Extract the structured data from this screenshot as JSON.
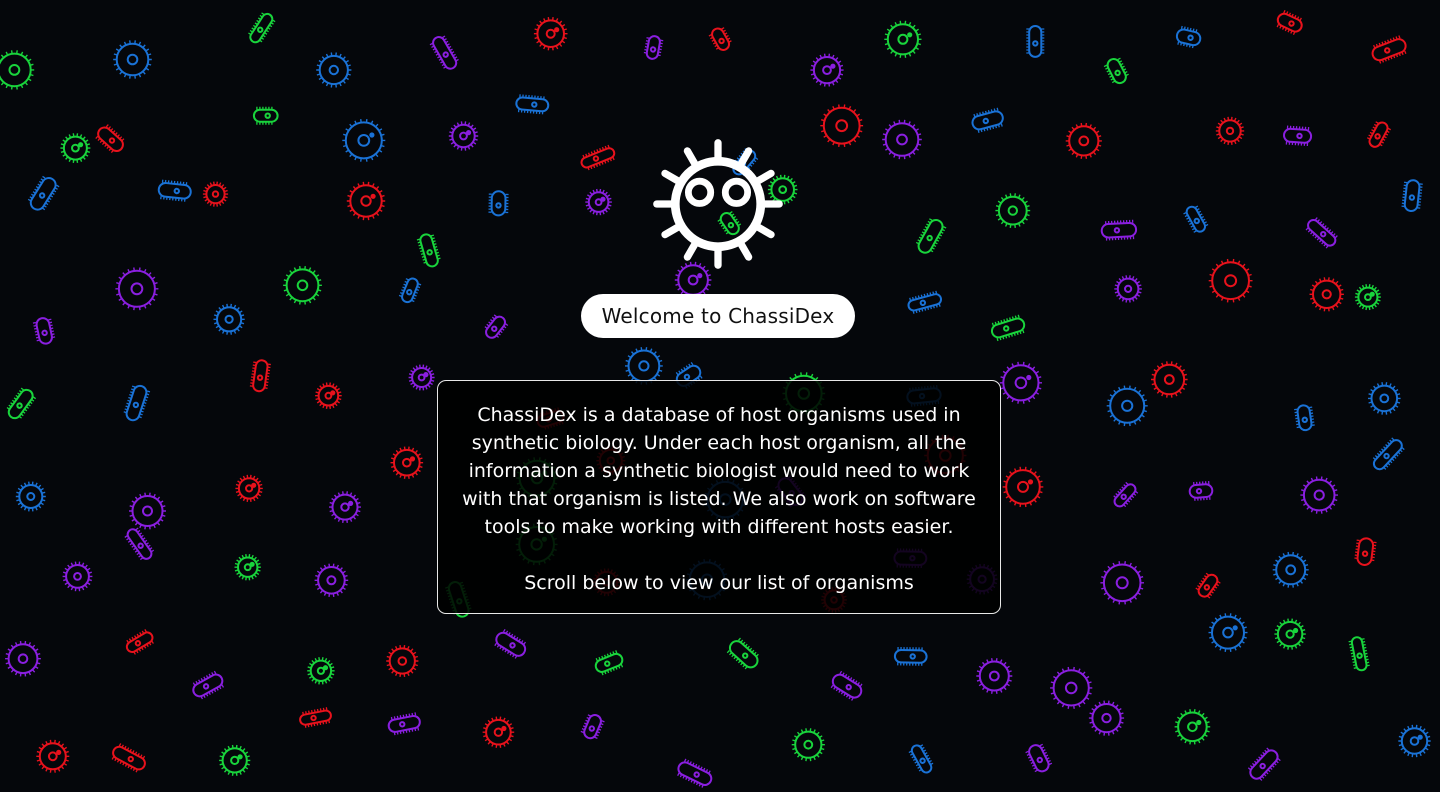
{
  "app": {
    "logo_icon": "cartoon-microbe-icon",
    "welcome_label": "Welcome to ChassiDex",
    "intro_text": "ChassiDex is a database of host organisms used in synthetic biology. Under each host organism, all the information a synthetic biologist would need to work with that organism is listed. We also work on software tools to make working with different hosts easier.",
    "scroll_hint": "Scroll below to view our list of organisms"
  },
  "theme": {
    "background": "#05070b",
    "microbe_colors": [
      "#e8121c",
      "#19d43c",
      "#8a1fe0",
      "#1a72d6"
    ],
    "text_color": "#ffffff"
  },
  "background": {
    "icon": "microbe-pattern",
    "motifs": [
      "spiky-cocci",
      "rod-bacilli"
    ]
  }
}
